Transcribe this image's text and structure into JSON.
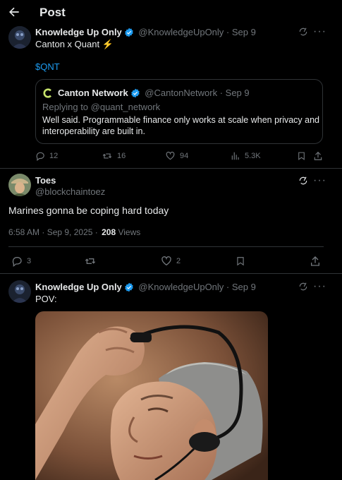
{
  "header": {
    "title": "Post",
    "back_icon": "arrow-left-icon"
  },
  "tweet1": {
    "author": "Knowledge Up Only",
    "handle": "@KnowledgeUpOnly",
    "date": "· Sep 9",
    "text": "Canton x Quant",
    "emoji": "⚡",
    "cashtag": "$QNT",
    "quote": {
      "author": "Canton Network",
      "handle": "@CantonNetwork",
      "date": "· Sep 9",
      "replying": "Replying to @quant_network",
      "text_line1": "Well said. Programmable finance only works at scale when privacy and",
      "text_line2": "interoperability are built in."
    },
    "stats": {
      "replies": "12",
      "reposts": "16",
      "likes": "94",
      "views": "5.3K"
    }
  },
  "tweet2": {
    "author": "Toes",
    "handle": "@blockchaintoez",
    "text": "Marines gonna be coping hard today",
    "timestamp": "6:58 AM · Sep 9, 2025 ·",
    "views_count": "208",
    "views_label": "Views",
    "stats": {
      "replies": "3",
      "likes": "2"
    }
  },
  "tweet3": {
    "author": "Knowledge Up Only",
    "handle": "@KnowledgeUpOnly",
    "date": "· Sep 9",
    "text": "POV:"
  },
  "colors": {
    "background": "#000000",
    "text": "#e7e9ea",
    "muted": "#71767b",
    "accent": "#1d9bf0",
    "divider": "#2f3336"
  }
}
